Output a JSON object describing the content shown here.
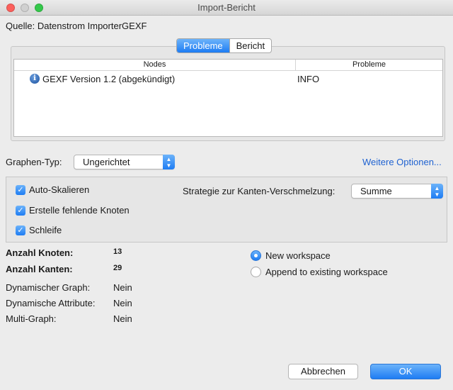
{
  "window": {
    "title": "Import-Bericht"
  },
  "source": {
    "label": "Quelle:",
    "value": "Datenstrom ImporterGEXF"
  },
  "tabs": [
    {
      "label": "Probleme",
      "active": true
    },
    {
      "label": "Bericht",
      "active": false
    }
  ],
  "issues_table": {
    "columns": [
      "Nodes",
      "Probleme"
    ],
    "rows": [
      {
        "icon": "info-icon",
        "node": "GEXF Version 1.2 (abgekündigt)",
        "problem": "INFO"
      }
    ]
  },
  "graph_type": {
    "label": "Graphen-Typ:",
    "selected": "Ungerichtet"
  },
  "more_options_link": "Weitere Optionen...",
  "options": {
    "checkboxes": [
      {
        "label": "Auto-Skalieren",
        "checked": true
      },
      {
        "label": "Erstelle fehlende Knoten",
        "checked": true
      },
      {
        "label": "Schleife",
        "checked": true
      }
    ],
    "merge_strategy": {
      "label": "Strategie zur Kanten-Verschmelzung:",
      "selected": "Summe"
    }
  },
  "stats": {
    "nodes": {
      "label": "Anzahl Knoten:",
      "value": "13"
    },
    "edges": {
      "label": "Anzahl Kanten:",
      "value": "29"
    },
    "dynamic_graph": {
      "label": "Dynamischer Graph:",
      "value": "Nein"
    },
    "dynamic_attributes": {
      "label": "Dynamische Attribute:",
      "value": "Nein"
    },
    "multi_graph": {
      "label": "Multi-Graph:",
      "value": "Nein"
    }
  },
  "workspace": {
    "options": [
      {
        "label": "New workspace",
        "selected": true
      },
      {
        "label": "Append to existing workspace",
        "selected": false
      }
    ]
  },
  "buttons": {
    "cancel": "Abbrechen",
    "ok": "OK"
  },
  "colors": {
    "accent": "#1e7cf3",
    "link": "#1f62d1",
    "close": "#fc605c",
    "maximize": "#34c84a"
  }
}
